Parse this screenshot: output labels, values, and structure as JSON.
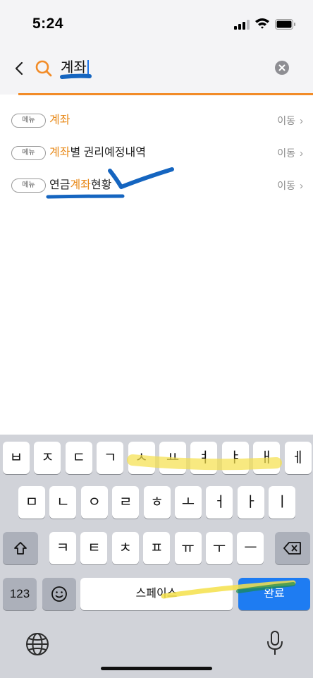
{
  "status_bar": {
    "time": "5:24"
  },
  "search": {
    "query": "계좌"
  },
  "results": [
    {
      "chip": "메뉴",
      "pre": "",
      "highlight": "계좌",
      "post": "",
      "action": "이동"
    },
    {
      "chip": "메뉴",
      "pre": "",
      "highlight": "계좌",
      "post": "별 권리예정내역",
      "action": "이동"
    },
    {
      "chip": "메뉴",
      "pre": "연금",
      "highlight": "계좌",
      "post": "현황",
      "action": "이동"
    }
  ],
  "keyboard": {
    "row1": [
      "ㅂ",
      "ㅈ",
      "ㄷ",
      "ㄱ",
      "ㅅ",
      "ㅛ",
      "ㅕ",
      "ㅑ",
      "ㅐ",
      "ㅔ"
    ],
    "row2": [
      "ㅁ",
      "ㄴ",
      "ㅇ",
      "ㄹ",
      "ㅎ",
      "ㅗ",
      "ㅓ",
      "ㅏ",
      "ㅣ"
    ],
    "row3": [
      "ㅋ",
      "ㅌ",
      "ㅊ",
      "ㅍ",
      "ㅠ",
      "ㅜ",
      "ㅡ"
    ],
    "numbers_label": "123",
    "space_label": "스페이스",
    "done_label": "완료"
  },
  "colors": {
    "accent": "#f28c28",
    "highlight_text": "#e88a1a",
    "done_key": "#1e7cf2",
    "annotation_blue": "#1565c0",
    "annotation_yellow": "#f5e04a"
  }
}
